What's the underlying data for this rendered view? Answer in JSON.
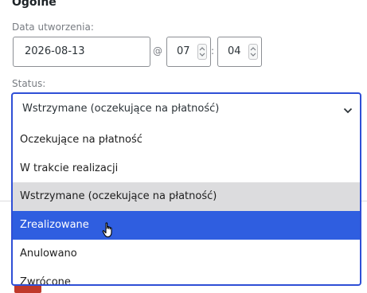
{
  "section": {
    "title": "Ogólne"
  },
  "date_field": {
    "label": "Data utworzenia:",
    "date_value": "2026-08-13",
    "at_symbol": "@",
    "hour_value": "07",
    "time_separator": ":",
    "minute_value": "04"
  },
  "status_field": {
    "label": "Status:",
    "selected": "Wstrzymane (oczekujące na płatność)",
    "options": [
      {
        "label": "Oczekujące na płatność"
      },
      {
        "label": "W trakcie realizacji"
      },
      {
        "label": "Wstrzymane (oczekujące na płatność)",
        "state": "selected"
      },
      {
        "label": "Zrealizowane",
        "state": "hovered"
      },
      {
        "label": "Anulowano"
      },
      {
        "label": "Zwrócone"
      }
    ]
  },
  "colors": {
    "focus_border": "#2f4fd6",
    "hover_background": "#2f5ee0",
    "selected_background": "#dcdcde"
  },
  "icons": {
    "chevron": "chevron-down-icon",
    "spinner": "spinner-arrows-icon",
    "cursor": "hand-pointer-icon"
  }
}
